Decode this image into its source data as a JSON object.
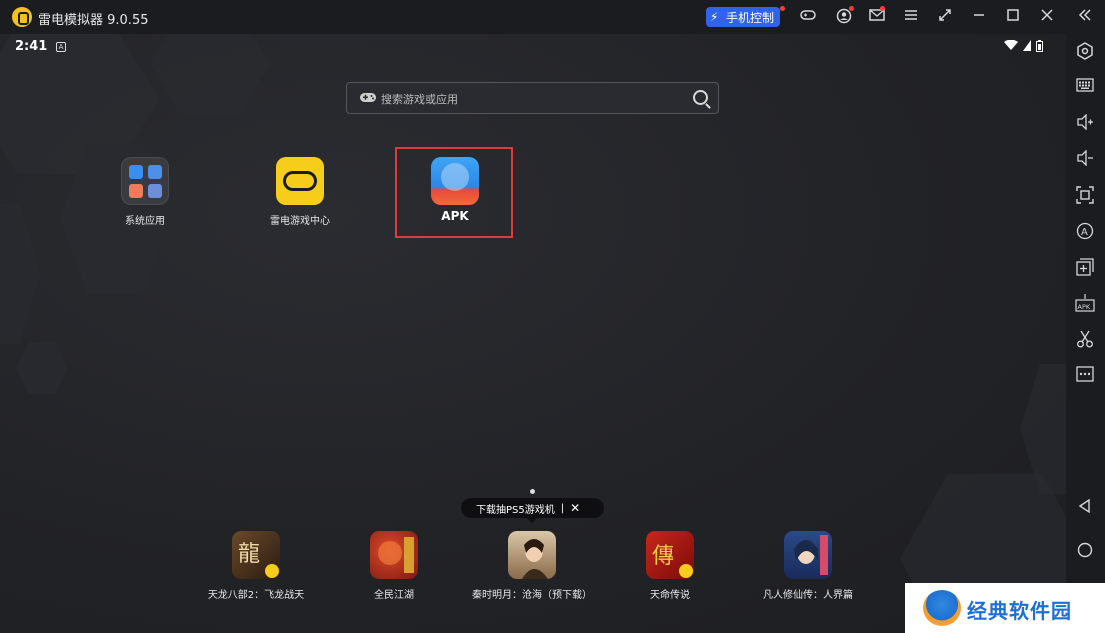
{
  "window": {
    "title": "雷电模拟器 9.0.55",
    "phone_control_label": "手机控制"
  },
  "status_bar": {
    "time": "2:41",
    "notification_letter": "A"
  },
  "search": {
    "placeholder": "搜索游戏或应用"
  },
  "desktop_apps": [
    {
      "label": "系统应用"
    },
    {
      "label": "雷电游戏中心"
    },
    {
      "label": "APK"
    }
  ],
  "promo_tooltip": {
    "text": "下载抽PS5游戏机",
    "separator": "|",
    "close": "✕"
  },
  "dock_games": [
    {
      "label": "天龙八部2：飞龙战天"
    },
    {
      "label": "全民江湖"
    },
    {
      "label": "秦时明月：沧海（预下载）"
    },
    {
      "label": "天命传说"
    },
    {
      "label": "凡人修仙传：人界篇"
    }
  ],
  "watermark": {
    "text": "经典软件园"
  },
  "colors": {
    "accent_blue": "#2f64e8",
    "highlight_red": "#e03a3a",
    "logo_yellow": "#f4c21a"
  }
}
